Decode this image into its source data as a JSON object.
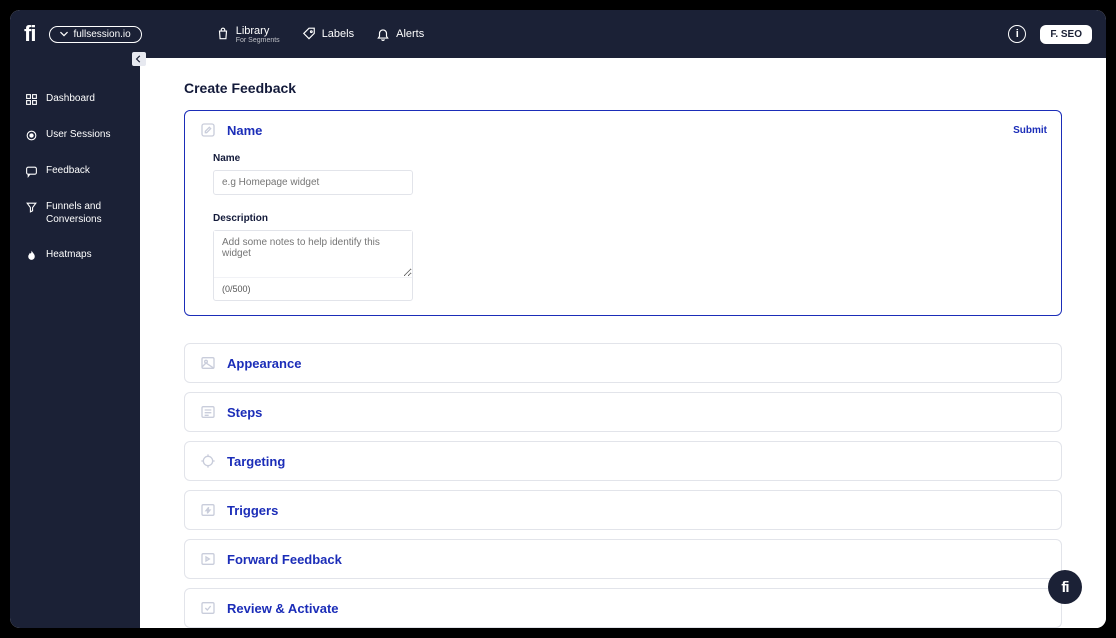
{
  "header": {
    "logo": "fi",
    "site_selector": "fullsession.io",
    "nav": {
      "library": {
        "label": "Library",
        "sub": "For Segments"
      },
      "labels": {
        "label": "Labels"
      },
      "alerts": {
        "label": "Alerts"
      }
    },
    "user_badge": "F. SEO"
  },
  "sidebar": {
    "items": [
      {
        "label": "Dashboard"
      },
      {
        "label": "User Sessions"
      },
      {
        "label": "Feedback"
      },
      {
        "label": "Funnels and Conversions"
      },
      {
        "label": "Heatmaps"
      }
    ]
  },
  "page": {
    "title": "Create Feedback",
    "submit": "Submit",
    "sections": {
      "name": {
        "title": "Name",
        "name_label": "Name",
        "name_placeholder": "e.g Homepage widget",
        "desc_label": "Description",
        "desc_placeholder": "Add some notes to help identify this widget",
        "counter": "(0/500)"
      },
      "appearance": {
        "title": "Appearance"
      },
      "steps": {
        "title": "Steps"
      },
      "targeting": {
        "title": "Targeting"
      },
      "triggers": {
        "title": "Triggers"
      },
      "forward": {
        "title": "Forward Feedback"
      },
      "review": {
        "title": "Review & Activate"
      }
    }
  },
  "float_badge": "fi"
}
